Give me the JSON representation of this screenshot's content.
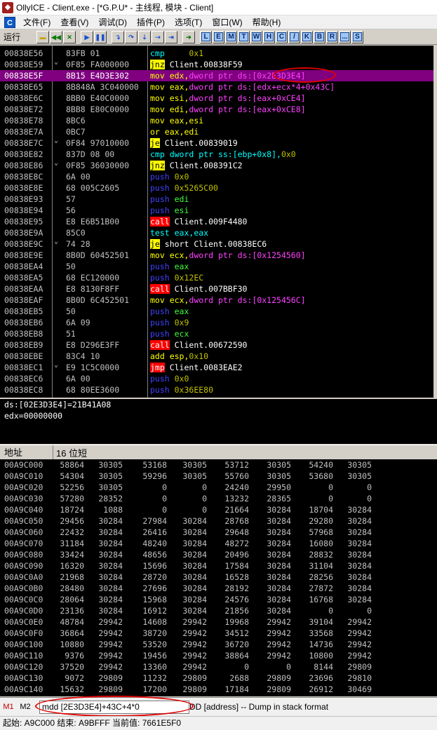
{
  "title": "OllyICE - Client.exe - [*G.P.U* - 主线程, 模块 - Client]",
  "menu": [
    "文件(F)",
    "查看(V)",
    "调试(D)",
    "插件(P)",
    "选项(T)",
    "窗口(W)",
    "帮助(H)"
  ],
  "toolbar": {
    "status": "运行",
    "letters": [
      "L",
      "E",
      "M",
      "T",
      "W",
      "H",
      "C",
      "/",
      "K",
      "B",
      "R",
      "...",
      "S"
    ]
  },
  "disasm": [
    {
      "addr": "00838E56",
      "arrow": "",
      "hex": "83FB 01",
      "parts": [
        [
          "cmp",
          "c-cyan"
        ],
        [
          " ebx,",
          ""
        ],
        [
          "0x1",
          "c-olive"
        ]
      ]
    },
    {
      "addr": "00838E59",
      "arrow": "⌄",
      "hex": "0F85 FA000000",
      "parts": [
        [
          "jnz",
          "hl-jmp"
        ],
        [
          " Client.00838F59",
          "c-white"
        ]
      ]
    },
    {
      "addr": "00838E5F",
      "arrow": "",
      "hex": "8B15 E4D3E302",
      "sel": true,
      "parts": [
        [
          "mov",
          "c-yellow"
        ],
        [
          " edx,",
          "c-yellow"
        ],
        [
          "dword ptr ds:[",
          "c-magenta"
        ],
        [
          "0x2E3D3E4",
          "c-magenta"
        ],
        [
          "]",
          "c-magenta"
        ]
      ]
    },
    {
      "addr": "00838E65",
      "arrow": "",
      "hex": "8B848A 3C040000",
      "parts": [
        [
          "mov",
          "c-yellow"
        ],
        [
          " eax,",
          "c-yellow"
        ],
        [
          "dword ptr ds:[edx+ecx*4+0x43C]",
          "c-magenta"
        ]
      ]
    },
    {
      "addr": "00838E6C",
      "arrow": "",
      "hex": "8BB0 E40C0000",
      "parts": [
        [
          "mov",
          "c-yellow"
        ],
        [
          " esi,",
          "c-yellow"
        ],
        [
          "dword ptr ds:[eax+0xCE4]",
          "c-magenta"
        ]
      ]
    },
    {
      "addr": "00838E72",
      "arrow": "",
      "hex": "8BB8 E80C0000",
      "parts": [
        [
          "mov",
          "c-yellow"
        ],
        [
          " edi,",
          "c-yellow"
        ],
        [
          "dword ptr ds:[eax+0xCE8]",
          "c-magenta"
        ]
      ]
    },
    {
      "addr": "00838E78",
      "arrow": "",
      "hex": "8BC6",
      "parts": [
        [
          "mov",
          "c-yellow"
        ],
        [
          " eax,esi",
          "c-yellow"
        ]
      ]
    },
    {
      "addr": "00838E7A",
      "arrow": "",
      "hex": "0BC7",
      "parts": [
        [
          "or",
          "c-yellow"
        ],
        [
          " eax,edi",
          "c-yellow"
        ]
      ]
    },
    {
      "addr": "00838E7C",
      "arrow": "⌄",
      "hex": "0F84 97010000",
      "parts": [
        [
          "je",
          "hl-jmp"
        ],
        [
          " Client.00839019",
          "c-white"
        ]
      ]
    },
    {
      "addr": "00838E82",
      "arrow": "",
      "hex": "837D 08 00",
      "parts": [
        [
          "cmp",
          "c-cyan"
        ],
        [
          " dword ptr ss:[ebp+0x8],",
          "c-cyan"
        ],
        [
          "0x0",
          "c-olive"
        ]
      ]
    },
    {
      "addr": "00838E86",
      "arrow": "⌄",
      "hex": "0F85 36030000",
      "parts": [
        [
          "jnz",
          "hl-jmp"
        ],
        [
          " Client.008391C2",
          "c-white"
        ]
      ]
    },
    {
      "addr": "00838E8C",
      "arrow": "",
      "hex": "6A 00",
      "parts": [
        [
          "push",
          "c-blue"
        ],
        [
          " 0x0",
          "c-olive"
        ]
      ]
    },
    {
      "addr": "00838E8E",
      "arrow": "",
      "hex": "68 005C2605",
      "parts": [
        [
          "push",
          "c-blue"
        ],
        [
          " 0x5265C00",
          "c-olive"
        ]
      ]
    },
    {
      "addr": "00838E93",
      "arrow": "",
      "hex": "57",
      "parts": [
        [
          "push",
          "c-blue"
        ],
        [
          " edi",
          "c-green"
        ]
      ]
    },
    {
      "addr": "00838E94",
      "arrow": "",
      "hex": "56",
      "parts": [
        [
          "push",
          "c-blue"
        ],
        [
          " esi",
          "c-green"
        ]
      ]
    },
    {
      "addr": "00838E95",
      "arrow": "",
      "hex": "E8 E6B51B00",
      "parts": [
        [
          "call",
          "hl-call"
        ],
        [
          " Client.009F4480",
          "c-white"
        ]
      ]
    },
    {
      "addr": "00838E9A",
      "arrow": "",
      "hex": "85C0",
      "parts": [
        [
          "test",
          "c-cyan"
        ],
        [
          " eax,eax",
          "c-cyan"
        ]
      ]
    },
    {
      "addr": "00838E9C",
      "arrow": "⌄",
      "hex": "74 28",
      "parts": [
        [
          "je",
          "hl-jmp"
        ],
        [
          " short Client.00838EC6",
          "c-white"
        ]
      ]
    },
    {
      "addr": "00838E9E",
      "arrow": "",
      "hex": "8B0D 60452501",
      "parts": [
        [
          "mov",
          "c-yellow"
        ],
        [
          " ecx,",
          "c-yellow"
        ],
        [
          "dword ptr ds:[0x1254560]",
          "c-magenta"
        ]
      ]
    },
    {
      "addr": "00838EA4",
      "arrow": "",
      "hex": "50",
      "parts": [
        [
          "push",
          "c-blue"
        ],
        [
          " eax",
          "c-green"
        ]
      ]
    },
    {
      "addr": "00838EA5",
      "arrow": "",
      "hex": "68 EC120000",
      "parts": [
        [
          "push",
          "c-blue"
        ],
        [
          " 0x12EC",
          "c-olive"
        ]
      ]
    },
    {
      "addr": "00838EAA",
      "arrow": "",
      "hex": "E8 8130F8FF",
      "parts": [
        [
          "call",
          "hl-call"
        ],
        [
          " Client.007BBF30",
          "c-white"
        ]
      ]
    },
    {
      "addr": "00838EAF",
      "arrow": "",
      "hex": "8B0D 6C452501",
      "parts": [
        [
          "mov",
          "c-yellow"
        ],
        [
          " ecx,",
          "c-yellow"
        ],
        [
          "dword ptr ds:[0x125456C]",
          "c-magenta"
        ]
      ]
    },
    {
      "addr": "00838EB5",
      "arrow": "",
      "hex": "50",
      "parts": [
        [
          "push",
          "c-blue"
        ],
        [
          " eax",
          "c-green"
        ]
      ]
    },
    {
      "addr": "00838EB6",
      "arrow": "",
      "hex": "6A 09",
      "parts": [
        [
          "push",
          "c-blue"
        ],
        [
          " 0x9",
          "c-olive"
        ]
      ]
    },
    {
      "addr": "00838EB8",
      "arrow": "",
      "hex": "51",
      "parts": [
        [
          "push",
          "c-blue"
        ],
        [
          " ecx",
          "c-green"
        ]
      ]
    },
    {
      "addr": "00838EB9",
      "arrow": "",
      "hex": "E8 D296E3FF",
      "parts": [
        [
          "call",
          "hl-call"
        ],
        [
          " Client.00672590",
          "c-white"
        ]
      ]
    },
    {
      "addr": "00838EBE",
      "arrow": "",
      "hex": "83C4 10",
      "parts": [
        [
          "add",
          "c-yellow"
        ],
        [
          " esp,",
          "c-yellow"
        ],
        [
          "0x10",
          "c-olive"
        ]
      ]
    },
    {
      "addr": "00838EC1",
      "arrow": "⌄",
      "hex": "E9 1C5C0000",
      "parts": [
        [
          "jmp",
          "hl-call"
        ],
        [
          " Client.0083EAE2",
          "c-white"
        ]
      ]
    },
    {
      "addr": "00838EC6",
      "arrow": "",
      "hex": "6A 00",
      "parts": [
        [
          "push",
          "c-blue"
        ],
        [
          " 0x0",
          "c-olive"
        ]
      ]
    },
    {
      "addr": "00838EC8",
      "arrow": "",
      "hex": "68 80EE3600",
      "parts": [
        [
          "push",
          "c-blue"
        ],
        [
          " 0x36EE80",
          "c-olive"
        ]
      ]
    }
  ],
  "info": {
    "line1": "ds:[02E3D3E4]=21B41A08",
    "line2": "edx=00000000"
  },
  "dump_header": {
    "addr": "地址",
    "type": "16 位短"
  },
  "dump": [
    {
      "addr": "00A9C000",
      "v": [
        "58864",
        "30305",
        "53168",
        "30305",
        "53712",
        "30305",
        "54240",
        "30305"
      ]
    },
    {
      "addr": "00A9C010",
      "v": [
        "54304",
        "30305",
        "59296",
        "30305",
        "55760",
        "30305",
        "53680",
        "30305"
      ]
    },
    {
      "addr": "00A9C020",
      "v": [
        "52256",
        "30305",
        "0",
        "0",
        "24240",
        "29950",
        "0",
        "0"
      ]
    },
    {
      "addr": "00A9C030",
      "v": [
        "57280",
        "28352",
        "0",
        "0",
        "13232",
        "28365",
        "0",
        "0"
      ]
    },
    {
      "addr": "00A9C040",
      "v": [
        "18724",
        "1088",
        "0",
        "0",
        "21664",
        "30284",
        "18704",
        "30284"
      ]
    },
    {
      "addr": "00A9C050",
      "v": [
        "29456",
        "30284",
        "27984",
        "30284",
        "28768",
        "30284",
        "29280",
        "30284"
      ]
    },
    {
      "addr": "00A9C060",
      "v": [
        "22432",
        "30284",
        "26416",
        "30284",
        "29648",
        "30284",
        "57968",
        "30284"
      ]
    },
    {
      "addr": "00A9C070",
      "v": [
        "31184",
        "30284",
        "48240",
        "30284",
        "48272",
        "30284",
        "16080",
        "30284"
      ]
    },
    {
      "addr": "00A9C080",
      "v": [
        "33424",
        "30284",
        "48656",
        "30284",
        "20496",
        "30284",
        "28832",
        "30284"
      ]
    },
    {
      "addr": "00A9C090",
      "v": [
        "16320",
        "30284",
        "15696",
        "30284",
        "17584",
        "30284",
        "31104",
        "30284"
      ]
    },
    {
      "addr": "00A9C0A0",
      "v": [
        "21968",
        "30284",
        "28720",
        "30284",
        "16528",
        "30284",
        "28256",
        "30284"
      ]
    },
    {
      "addr": "00A9C0B0",
      "v": [
        "28480",
        "30284",
        "27696",
        "30284",
        "28192",
        "30284",
        "27872",
        "30284"
      ]
    },
    {
      "addr": "00A9C0C0",
      "v": [
        "28064",
        "30284",
        "15968",
        "30284",
        "24576",
        "30284",
        "16768",
        "30284"
      ]
    },
    {
      "addr": "00A9C0D0",
      "v": [
        "23136",
        "30284",
        "16912",
        "30284",
        "21856",
        "30284",
        "0",
        "0"
      ]
    },
    {
      "addr": "00A9C0E0",
      "v": [
        "48784",
        "29942",
        "14608",
        "29942",
        "19968",
        "29942",
        "39104",
        "29942"
      ]
    },
    {
      "addr": "00A9C0F0",
      "v": [
        "36864",
        "29942",
        "38720",
        "29942",
        "34512",
        "29942",
        "33568",
        "29942"
      ]
    },
    {
      "addr": "00A9C100",
      "v": [
        "10880",
        "29942",
        "53520",
        "29942",
        "36720",
        "29942",
        "14736",
        "29942"
      ]
    },
    {
      "addr": "00A9C110",
      "v": [
        "9376",
        "29942",
        "19456",
        "29942",
        "38864",
        "29942",
        "10800",
        "29942"
      ]
    },
    {
      "addr": "00A9C120",
      "v": [
        "37520",
        "29942",
        "13360",
        "29942",
        "0",
        "0",
        "8144",
        "29809"
      ]
    },
    {
      "addr": "00A9C130",
      "v": [
        "9072",
        "29809",
        "11232",
        "29809",
        "2688",
        "29809",
        "23696",
        "29810"
      ]
    },
    {
      "addr": "00A9C140",
      "v": [
        "15632",
        "29809",
        "17200",
        "29809",
        "17184",
        "29809",
        "26912",
        "30469"
      ]
    }
  ],
  "cmd": {
    "m1": "M1",
    "m2": "M2",
    "value": "mdd [2E3D3E4]+43C+4*0",
    "hint": "DD [address] -- Dump in stack format"
  },
  "statusbar": {
    "text": "起始: A9C000  结束: A9BFFF  当前值: 7661E5F0"
  }
}
